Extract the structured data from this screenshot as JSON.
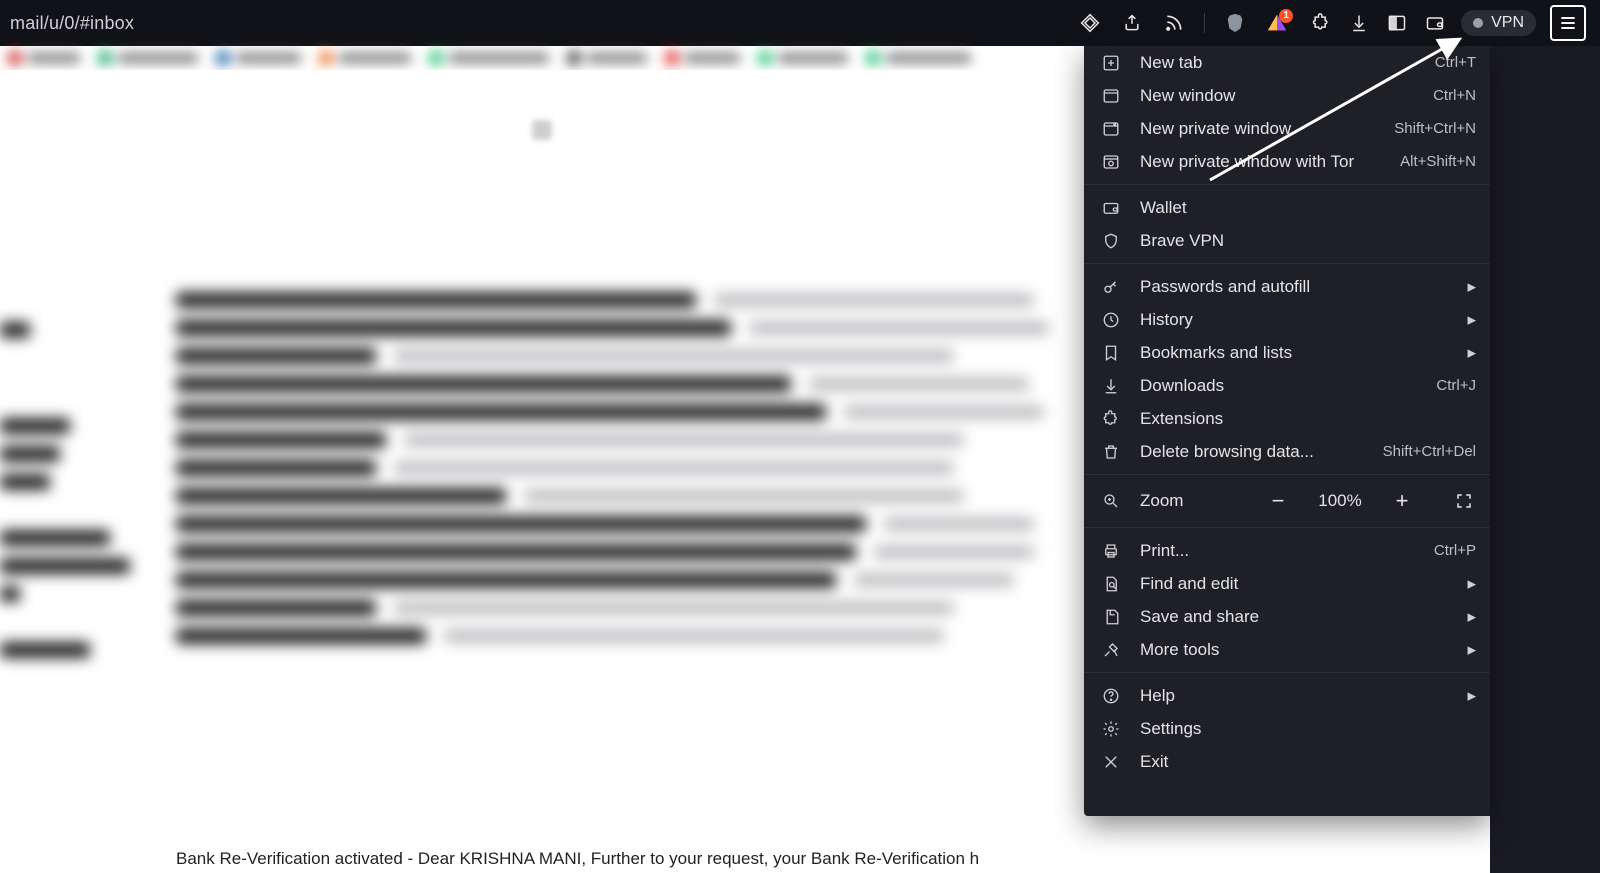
{
  "toolbar": {
    "url_fragment": "mail/u/0/#inbox",
    "vpn_label": "VPN",
    "brave_badge_count": "1"
  },
  "menu": {
    "new_tab": {
      "label": "New tab",
      "accel": "Ctrl+T"
    },
    "new_window": {
      "label": "New window",
      "accel": "Ctrl+N"
    },
    "new_private": {
      "label": "New private window",
      "accel": "Shift+Ctrl+N"
    },
    "new_private_tor": {
      "label": "New private window with Tor",
      "accel": "Alt+Shift+N"
    },
    "wallet": {
      "label": "Wallet"
    },
    "brave_vpn": {
      "label": "Brave VPN"
    },
    "passwords": {
      "label": "Passwords and autofill"
    },
    "history": {
      "label": "History"
    },
    "bookmarks": {
      "label": "Bookmarks and lists"
    },
    "downloads": {
      "label": "Downloads",
      "accel": "Ctrl+J"
    },
    "extensions": {
      "label": "Extensions"
    },
    "delete_data": {
      "label": "Delete browsing data...",
      "accel": "Shift+Ctrl+Del"
    },
    "zoom": {
      "label": "Zoom",
      "value": "100%"
    },
    "print": {
      "label": "Print...",
      "accel": "Ctrl+P"
    },
    "find_edit": {
      "label": "Find and edit"
    },
    "save_share": {
      "label": "Save and share"
    },
    "more_tools": {
      "label": "More tools"
    },
    "help": {
      "label": "Help"
    },
    "settings": {
      "label": "Settings"
    },
    "exit": {
      "label": "Exit"
    }
  },
  "page": {
    "bottom_visible_text": "Bank  Re-Verification activated - Dear KRISHNA MANI, Further to your request, your Bank  Re-Verification h"
  }
}
